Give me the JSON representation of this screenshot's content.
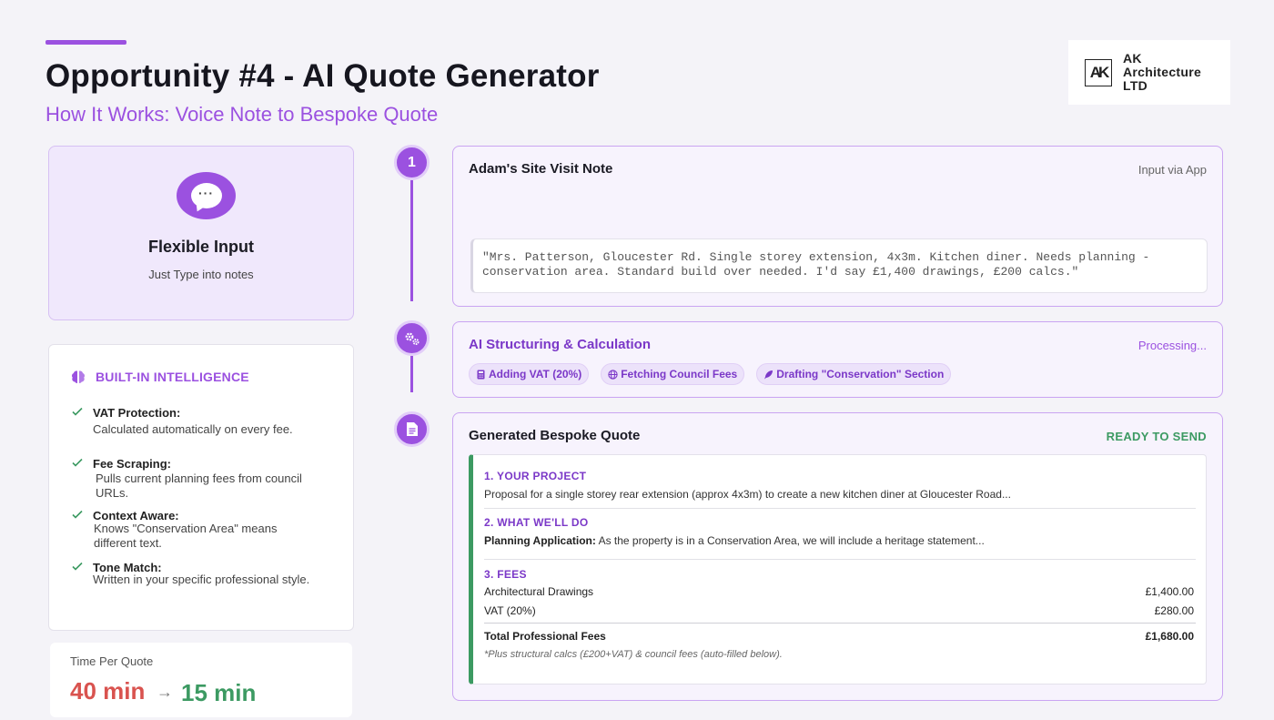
{
  "header": {
    "title": "Opportunity #4 - AI Quote Generator",
    "subtitle": "How It Works: Voice Note to Bespoke Quote"
  },
  "logo": {
    "mark": "AK",
    "line1": "AK",
    "line2": "Architecture",
    "line3": "LTD"
  },
  "input_card": {
    "title": "Flexible Input",
    "subtitle": "Just Type into notes"
  },
  "intelligence": {
    "title": "BUILT-IN INTELLIGENCE",
    "items": [
      {
        "label": "VAT Protection:",
        "desc": "Calculated automatically on every fee."
      },
      {
        "label": "Fee Scraping:",
        "desc": "Pulls current planning fees from council URLs."
      },
      {
        "label": "Context Aware:",
        "desc": "Knows \"Conservation Area\" means different text."
      },
      {
        "label": "Tone Match:",
        "desc": "Written in your specific professional style."
      }
    ]
  },
  "time": {
    "label": "Time Per Quote",
    "before": "40 min",
    "arrow": "→",
    "after": "15 min"
  },
  "steps": {
    "one": {
      "number": "1",
      "title": "Adam's Site Visit Note",
      "status": "Input via App",
      "note": "\"Mrs. Patterson, Gloucester Rd. Single storey extension, 4x3m. Kitchen diner. Needs planning - conservation area. Standard build over needed. I'd say £1,400 drawings, £200 calcs.\""
    },
    "two": {
      "title": "AI Structuring & Calculation",
      "status": "Processing...",
      "chips": [
        "Adding VAT (20%)",
        "Fetching Council Fees",
        "Drafting \"Conservation\" Section"
      ]
    },
    "three": {
      "title": "Generated Bespoke Quote",
      "status": "READY TO SEND",
      "sections": {
        "project_head": "1. YOUR PROJECT",
        "project_text": "Proposal for a single storey rear extension (approx 4x3m) to create a new kitchen diner at Gloucester Road...",
        "do_head": "2. WHAT WE'LL DO",
        "do_label": "Planning Application:",
        "do_text": " As the property is in a Conservation Area, we will include a heritage statement...",
        "fees_head": "3. FEES",
        "fees": [
          {
            "label": "Architectural Drawings",
            "value": "£1,400.00"
          },
          {
            "label": "VAT (20%)",
            "value": "£280.00"
          }
        ],
        "total_label": "Total Professional Fees",
        "total_value": "£1,680.00",
        "footnote": "*Plus structural calcs (£200+VAT) & council fees (auto-filled below)."
      }
    }
  },
  "colors": {
    "accent": "#9b51e0",
    "success": "#3c9a62",
    "danger": "#d9534f"
  }
}
